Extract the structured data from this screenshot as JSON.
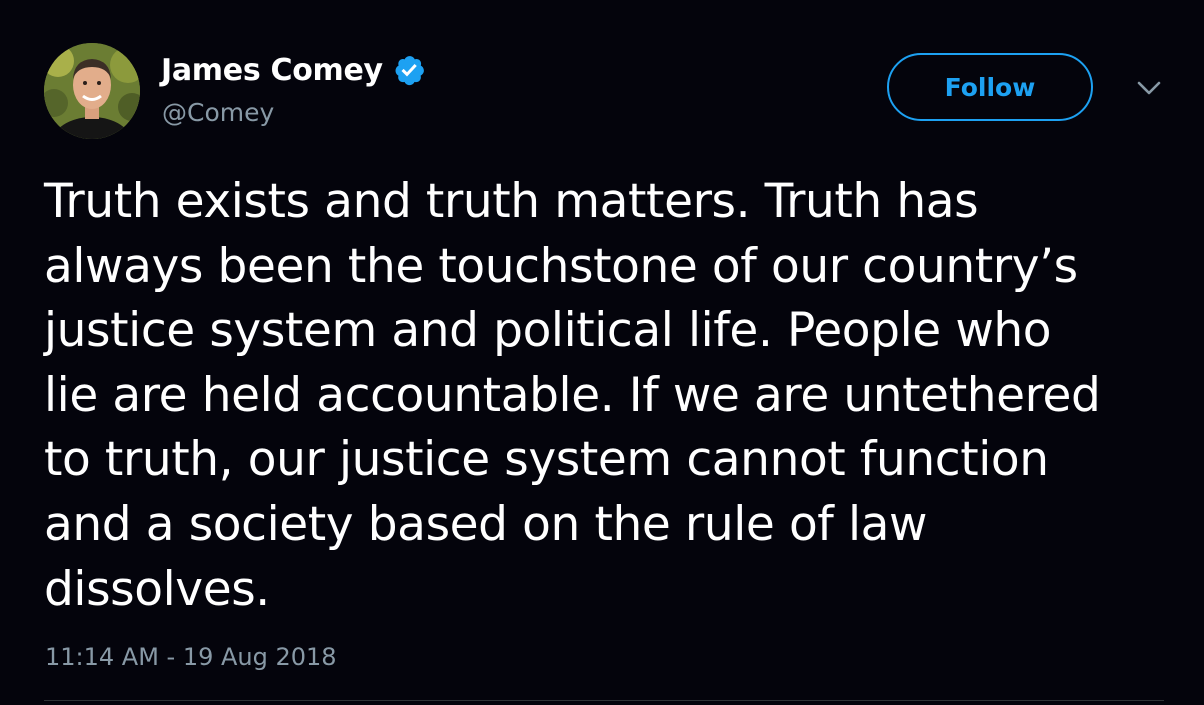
{
  "author": {
    "display_name": "James Comey",
    "handle": "@Comey",
    "verified": true
  },
  "actions": {
    "follow_label": "Follow",
    "more_icon": "chevron-down-icon"
  },
  "tweet": {
    "lines": [
      "Truth exists and truth matters. Truth has",
      "always been the touchstone of our country’s",
      "justice system and political life. People who",
      "lie are held accountable. If we are untethered",
      "to truth, our justice system cannot function",
      "and a society based on the rule of law",
      "dissolves."
    ],
    "timestamp": "11:14 AM - 19 Aug 2018"
  },
  "colors": {
    "background": "#04040c",
    "accent": "#1da1f2",
    "secondary_text": "#8899a6",
    "primary_text": "#ffffff"
  }
}
